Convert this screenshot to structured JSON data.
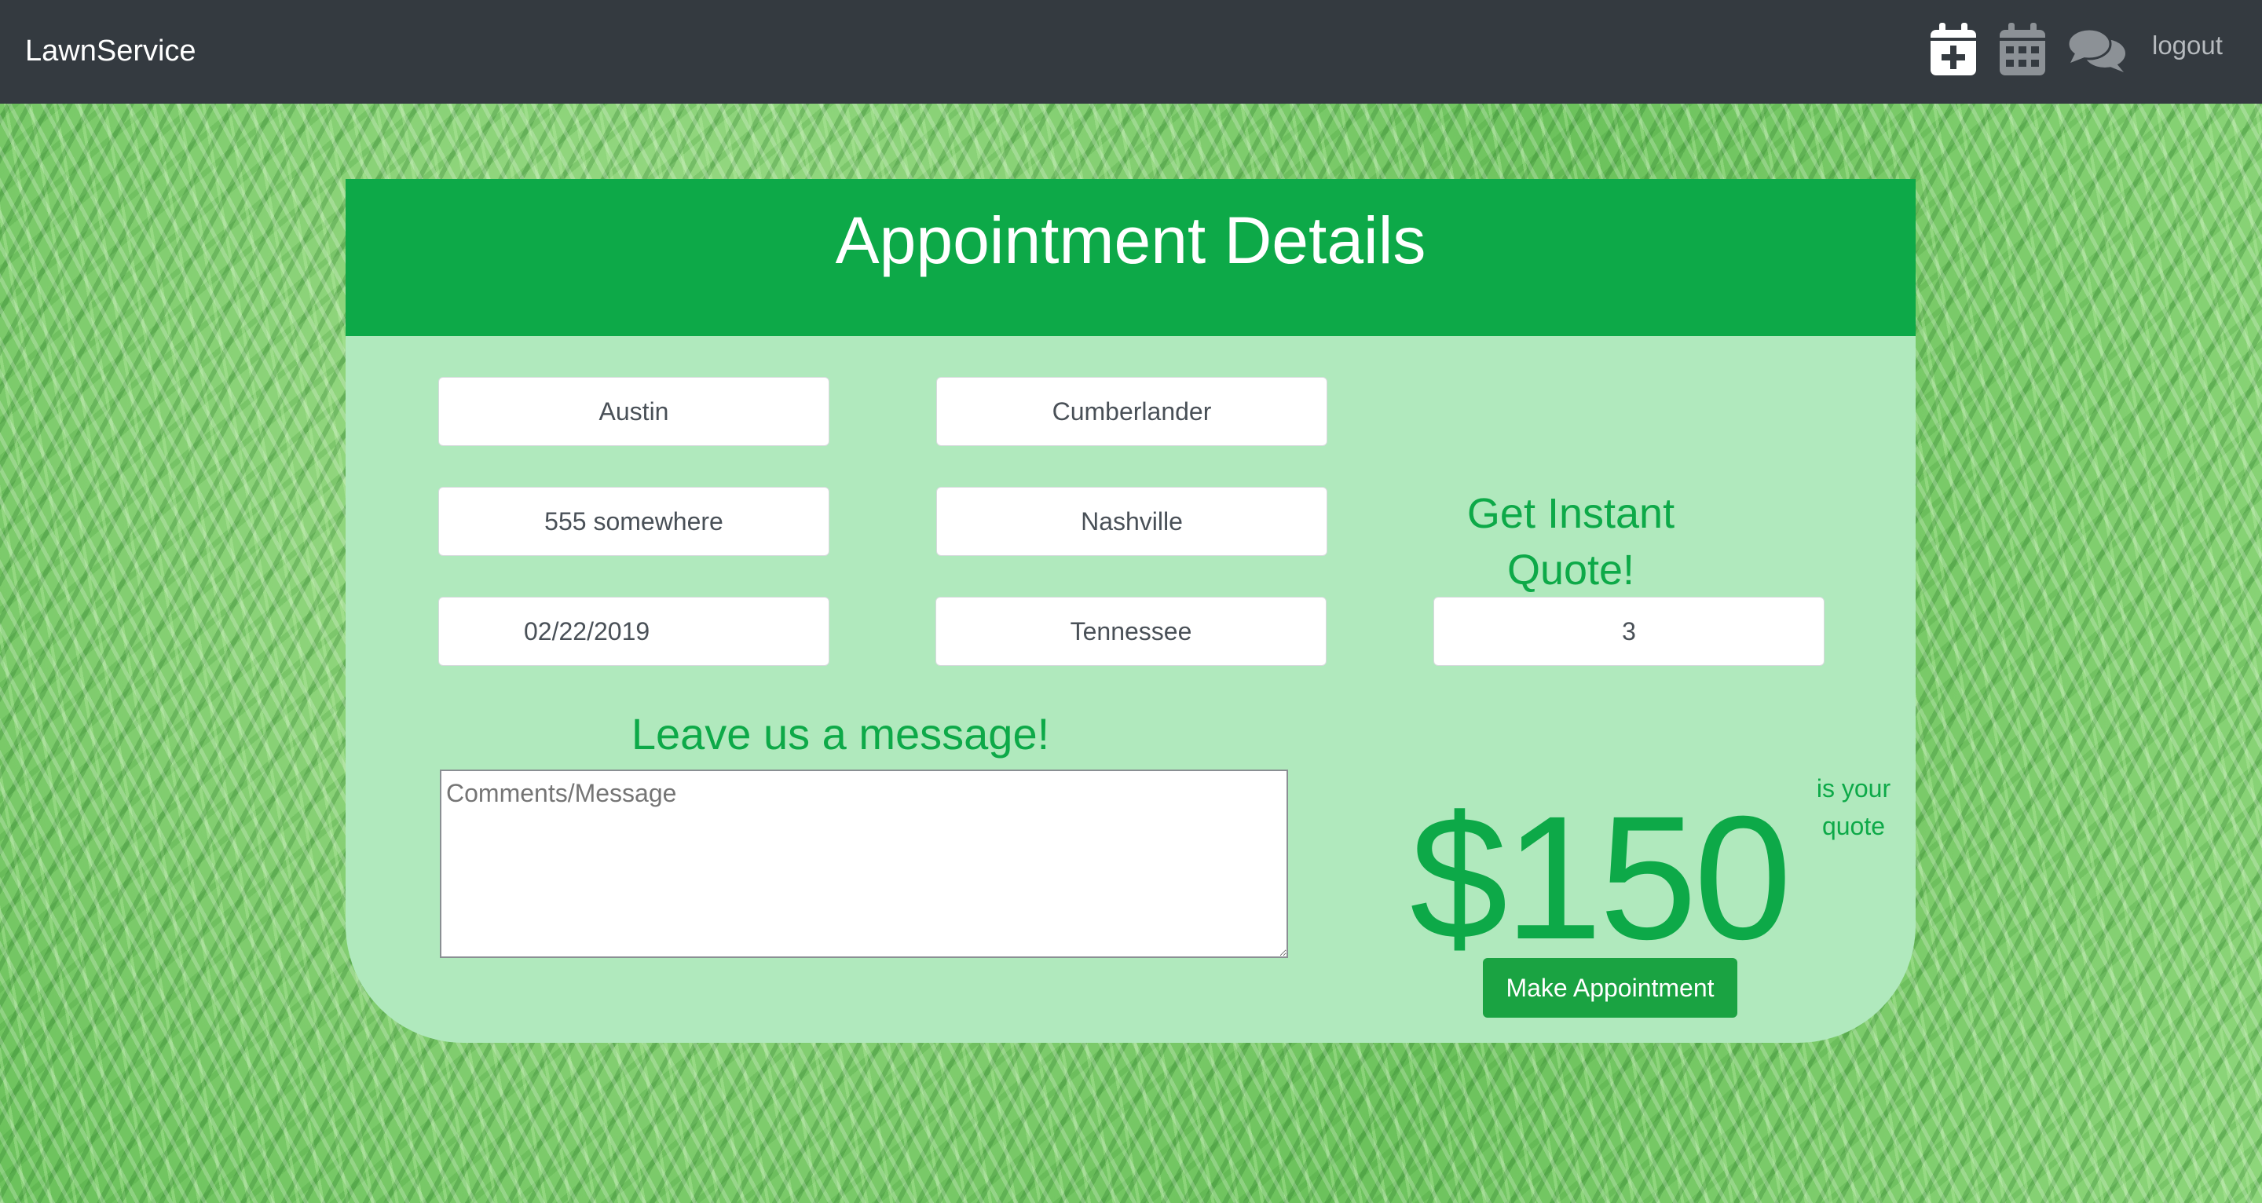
{
  "navbar": {
    "brand": "LawnService",
    "icons": [
      "calendar-plus-icon",
      "calendar-icon",
      "comments-icon"
    ],
    "logout_label": "logout"
  },
  "card": {
    "title": "Appointment Details",
    "fields": {
      "first_name": "Austin",
      "last_name": "Cumberlander",
      "address": "555 somewhere",
      "city": "Nashville",
      "date": "02/22/2019",
      "state": "Tennessee",
      "quantity": "3"
    },
    "quote_heading": "Get Instant Quote!",
    "message_heading": "Leave us a message!",
    "message_placeholder": "Comments/Message",
    "price": "$150",
    "quote_caption": "is your quote",
    "make_appointment_label": "Make Appointment"
  },
  "colors": {
    "navbar": "#343a40",
    "header_green": "#0da948",
    "card_background": "#b0e9bd",
    "accent_green": "#0da948",
    "button_green": "#1aa342"
  }
}
